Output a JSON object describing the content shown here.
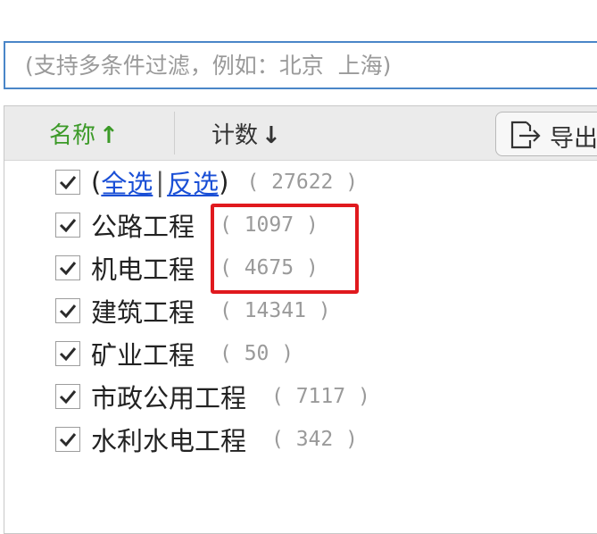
{
  "search": {
    "placeholder": "(支持多条件过滤，例如：北京  上海)"
  },
  "header": {
    "name_label": "名称",
    "name_arrow": "↑",
    "count_label": "计数",
    "count_arrow": "↓",
    "export_label": "导出"
  },
  "select_all": {
    "open_paren": "(",
    "all_label": "全选",
    "separator": "|",
    "invert_label": "反选",
    "close_paren": ")",
    "count": "( 27622 )",
    "checked": true
  },
  "items": [
    {
      "label": "公路工程",
      "count": "( 1097 )",
      "checked": true
    },
    {
      "label": "机电工程",
      "count": "( 4675 )",
      "checked": true
    },
    {
      "label": "建筑工程",
      "count": "( 14341 )",
      "checked": true
    },
    {
      "label": "矿业工程",
      "count": "( 50 )",
      "checked": true
    },
    {
      "label": "市政公用工程",
      "count": "( 7117 )",
      "checked": true
    },
    {
      "label": "水利水电工程",
      "count": "( 342 )",
      "checked": true
    }
  ],
  "colors": {
    "accent_green": "#3c9a28",
    "link_blue": "#1a4fd6",
    "highlight_red": "#e0191e",
    "search_border": "#4a86c8"
  }
}
